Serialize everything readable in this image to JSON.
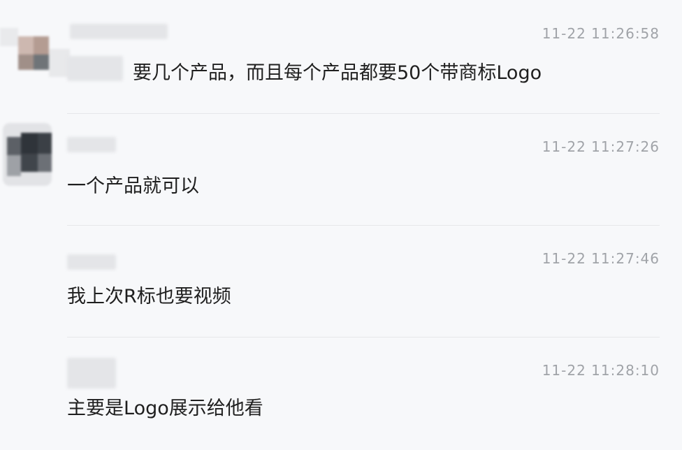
{
  "messages": [
    {
      "timestamp": "11-22 11:26:58",
      "text": "要几个产品，而且每个产品都要50个带商标Logo"
    },
    {
      "timestamp": "11-22 11:27:26",
      "text": "一个产品就可以"
    },
    {
      "timestamp": "11-22 11:27:46",
      "text": "我上次R标也要视频"
    },
    {
      "timestamp": "11-22 11:28:10",
      "text": "主要是Logo展示给他看"
    }
  ]
}
